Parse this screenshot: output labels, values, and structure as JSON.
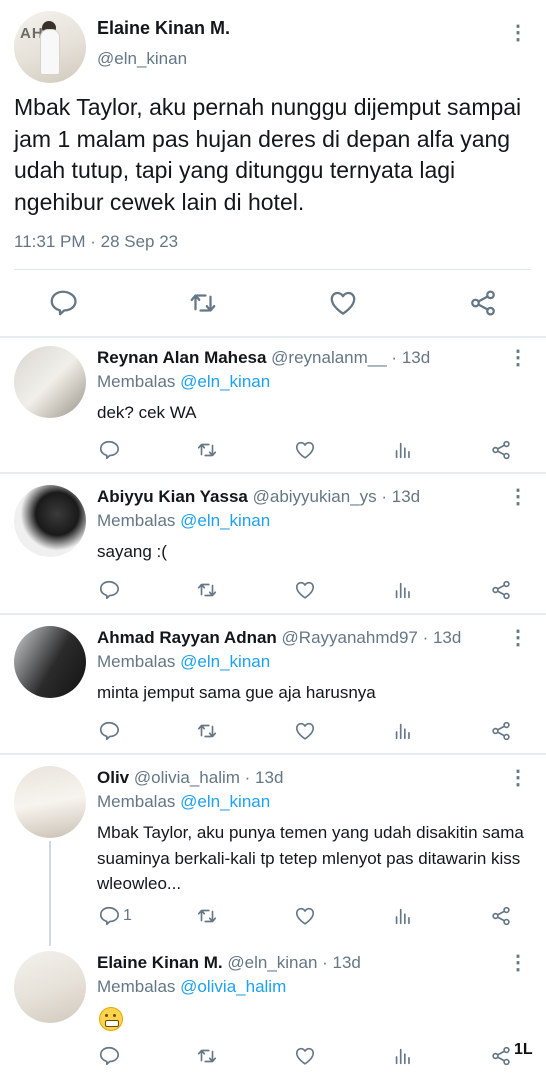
{
  "main_tweet": {
    "name": "Elaine Kinan M.",
    "handle": "@eln_kinan",
    "text": "Mbak Taylor, aku pernah nunggu dijemput sampai jam 1 malam pas hujan deres di depan alfa yang udah tutup, tapi yang ditunggu ternyata lagi ngehibur cewek lain di hotel.",
    "timestamp": "11:31 PM · 28 Sep 23",
    "avatar_letters": "AHZ",
    "actions": [
      "reply-icon",
      "retweet-icon",
      "like-icon",
      "share-icon"
    ]
  },
  "replying_prefix": "Membalas",
  "replies": [
    {
      "name": "Reynan Alan Mahesa",
      "meta": "@reynalanm__ · 13d",
      "replying_to": "@eln_kinan",
      "text": "dek? cek WA",
      "reply_count": ""
    },
    {
      "name": "Abiyyu Kian Yassa",
      "meta": "@abiyyukian_ys · 13d",
      "replying_to": "@eln_kinan",
      "text": "sayang :(",
      "reply_count": ""
    },
    {
      "name": "Ahmad Rayyan Adnan",
      "meta": "@Rayyanahmd97 · 13d",
      "replying_to": "@eln_kinan",
      "text": "minta jemput sama gue aja harusnya",
      "reply_count": ""
    },
    {
      "name": "Oliv",
      "meta": "@olivia_halim · 13d",
      "replying_to": "@eln_kinan",
      "text": "Mbak Taylor, aku punya temen yang udah disakitin sama suaminya berkali-kali tp tetep mlenyot pas ditawarin kiss wleowleo...",
      "reply_count": "1"
    },
    {
      "name": "Elaine Kinan M.",
      "meta": "@eln_kinan · 13d",
      "replying_to": "@olivia_halim",
      "text": "",
      "emoji": "grimacing-face-emoji",
      "reply_count": ""
    }
  ],
  "reply_action_icons": [
    "reply-icon",
    "retweet-icon",
    "like-icon",
    "analytics-icon",
    "share-icon"
  ],
  "watermark": "1L",
  "colors": {
    "text": "#14171a",
    "secondary": "#657786",
    "link": "#1da1f2",
    "divider": "#e1e8ed"
  }
}
